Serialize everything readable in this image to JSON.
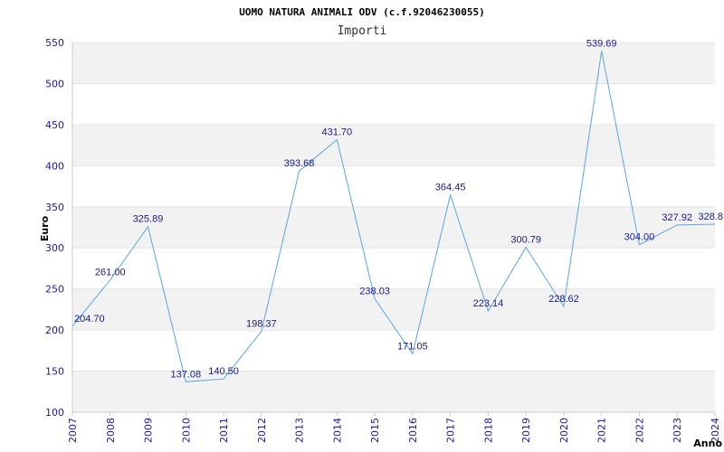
{
  "colors": {
    "line": "#5aa6e6",
    "band": "#f2f2f2",
    "tick_text": "#1a1aa8",
    "data_label": "#1a1a8c",
    "axis": "#cccccc"
  },
  "chart_data": {
    "type": "line",
    "title": "UOMO NATURA ANIMALI ODV (c.f.92046230055)",
    "subtitle": "Importi",
    "xlabel": "Anno",
    "ylabel": "Euro",
    "ylim": [
      100,
      550
    ],
    "y_ticks": [
      "100",
      "150",
      "200",
      "250",
      "300",
      "350",
      "400",
      "450",
      "500",
      "550"
    ],
    "grid": "alternating horizontal bands",
    "categories": [
      "2007",
      "2008",
      "2009",
      "2010",
      "2011",
      "2012",
      "2013",
      "2014",
      "2015",
      "2016",
      "2017",
      "2018",
      "2019",
      "2020",
      "2021",
      "2022",
      "2023",
      "2024"
    ],
    "values": [
      204.7,
      261.0,
      325.89,
      137.08,
      140.5,
      198.37,
      393.68,
      431.7,
      238.03,
      171.05,
      364.45,
      223.14,
      300.79,
      228.62,
      539.69,
      304.0,
      327.92,
      328.8
    ],
    "value_labels": [
      "204.70",
      "261.00",
      "325.89",
      "137.08",
      "140.50",
      "198.37",
      "393.68",
      "431.70",
      "238.03",
      "171.05",
      "364.45",
      "223.14",
      "300.79",
      "228.62",
      "539.69",
      "304.00",
      "327.92",
      "328.8"
    ]
  }
}
